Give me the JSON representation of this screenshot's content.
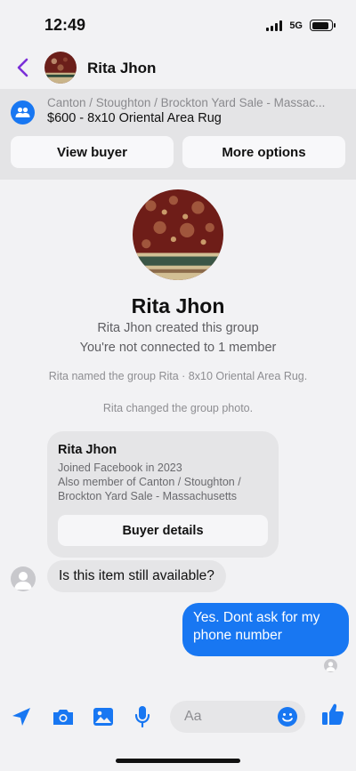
{
  "status": {
    "time": "12:49",
    "network": "5G",
    "battery_level": 0.9
  },
  "header": {
    "title": "Rita Jhon"
  },
  "listing": {
    "group": "Canton / Stoughton / Brockton Yard Sale - Massac...",
    "title": "$600 - 8x10 Oriental Area Rug",
    "view_buyer_label": "View buyer",
    "more_options_label": "More options"
  },
  "group_info": {
    "name": "Rita Jhon",
    "created_text": "Rita Jhon created this group",
    "connection_text": "You're not connected to 1 member",
    "system_messages": [
      "Rita named the group Rita · 8x10 Oriental Area Rug.",
      "Rita changed the group photo."
    ]
  },
  "buyer_card": {
    "name": "Rita Jhon",
    "lines": [
      "Joined Facebook in 2023",
      "Also member of Canton / Stoughton /",
      "Brockton Yard Sale - Massachusetts"
    ],
    "button_label": "Buyer details"
  },
  "messages": {
    "incoming": "Is this item still available?",
    "outgoing": "Yes. Dont ask for my phone number"
  },
  "composer": {
    "placeholder": "Aa"
  },
  "colors": {
    "accent": "#1877f2",
    "back": "#7b2fd8"
  }
}
